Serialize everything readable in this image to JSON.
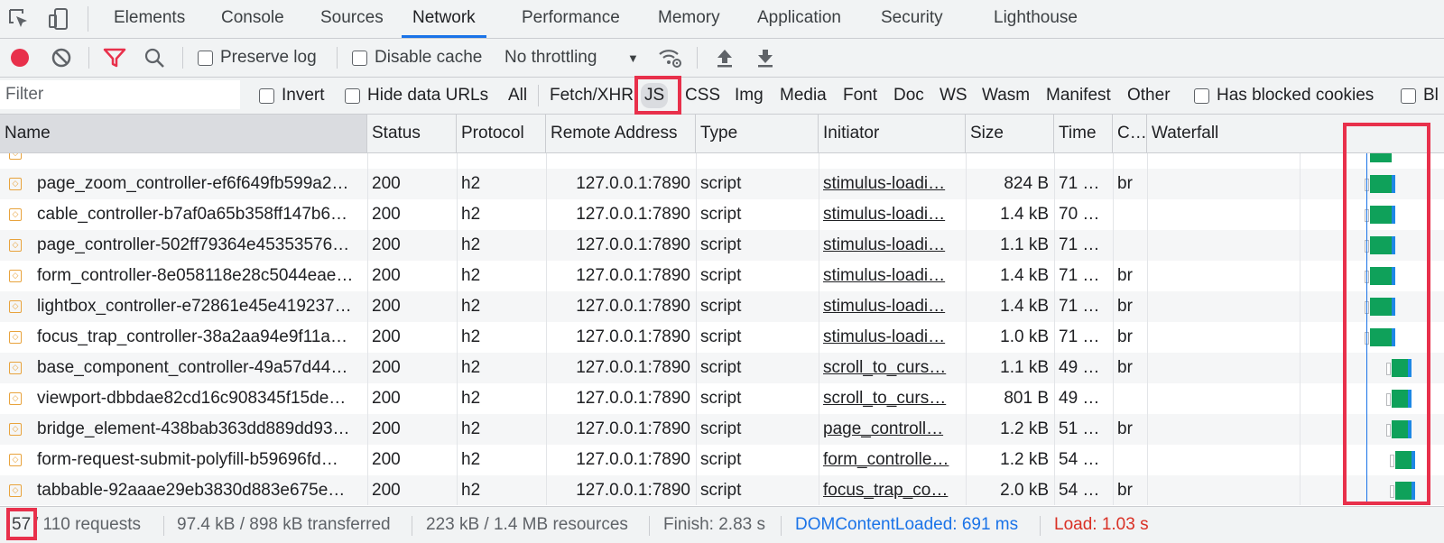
{
  "tabs": [
    "Elements",
    "Console",
    "Sources",
    "Network",
    "Performance",
    "Memory",
    "Application",
    "Security",
    "Lighthouse"
  ],
  "active_tab": "Network",
  "toolbar": {
    "preserve_log": "Preserve log",
    "disable_cache": "Disable cache",
    "throttling": "No throttling"
  },
  "filterbar": {
    "placeholder": "Filter",
    "invert": "Invert",
    "hide_data_urls": "Hide data URLs",
    "types": [
      "All",
      "Fetch/XHR",
      "JS",
      "CSS",
      "Img",
      "Media",
      "Font",
      "Doc",
      "WS",
      "Wasm",
      "Manifest",
      "Other"
    ],
    "selected_type": "JS",
    "has_blocked_cookies": "Has blocked cookies",
    "blocked_requests_partial": "Bl"
  },
  "columns": [
    "Name",
    "Status",
    "Protocol",
    "Remote Address",
    "Type",
    "Initiator",
    "Size",
    "Time",
    "C…",
    "Waterfall"
  ],
  "rows": [
    {
      "name": "page_zoom_controller-ef6f649fb599a2…",
      "status": "200",
      "protocol": "h2",
      "remote": "127.0.0.1:7890",
      "type": "script",
      "initiator": "stimulus-loadi…",
      "size": "824 B",
      "time": "71 …",
      "content_encoding": "br"
    },
    {
      "name": "cable_controller-b7af0a65b358ff147b6…",
      "status": "200",
      "protocol": "h2",
      "remote": "127.0.0.1:7890",
      "type": "script",
      "initiator": "stimulus-loadi…",
      "size": "1.4 kB",
      "time": "70 …",
      "content_encoding": ""
    },
    {
      "name": "page_controller-502ff79364e45353576…",
      "status": "200",
      "protocol": "h2",
      "remote": "127.0.0.1:7890",
      "type": "script",
      "initiator": "stimulus-loadi…",
      "size": "1.1 kB",
      "time": "71 …",
      "content_encoding": ""
    },
    {
      "name": "form_controller-8e058118e28c5044eae…",
      "status": "200",
      "protocol": "h2",
      "remote": "127.0.0.1:7890",
      "type": "script",
      "initiator": "stimulus-loadi…",
      "size": "1.4 kB",
      "time": "71 …",
      "content_encoding": "br"
    },
    {
      "name": "lightbox_controller-e72861e45e419237…",
      "status": "200",
      "protocol": "h2",
      "remote": "127.0.0.1:7890",
      "type": "script",
      "initiator": "stimulus-loadi…",
      "size": "1.4 kB",
      "time": "71 …",
      "content_encoding": "br"
    },
    {
      "name": "focus_trap_controller-38a2aa94e9f11a…",
      "status": "200",
      "protocol": "h2",
      "remote": "127.0.0.1:7890",
      "type": "script",
      "initiator": "stimulus-loadi…",
      "size": "1.0 kB",
      "time": "71 …",
      "content_encoding": "br"
    },
    {
      "name": "base_component_controller-49a57d44…",
      "status": "200",
      "protocol": "h2",
      "remote": "127.0.0.1:7890",
      "type": "script",
      "initiator": "scroll_to_curs…",
      "size": "1.1 kB",
      "time": "49 …",
      "content_encoding": "br"
    },
    {
      "name": "viewport-dbbdae82cd16c908345f15de…",
      "status": "200",
      "protocol": "h2",
      "remote": "127.0.0.1:7890",
      "type": "script",
      "initiator": "scroll_to_curs…",
      "size": "801 B",
      "time": "49 …",
      "content_encoding": ""
    },
    {
      "name": "bridge_element-438bab363dd889dd93…",
      "status": "200",
      "protocol": "h2",
      "remote": "127.0.0.1:7890",
      "type": "script",
      "initiator": "page_controll…",
      "size": "1.2 kB",
      "time": "51 …",
      "content_encoding": "br"
    },
    {
      "name": "form-request-submit-polyfill-b59696fd…",
      "status": "200",
      "protocol": "h2",
      "remote": "127.0.0.1:7890",
      "type": "script",
      "initiator": "form_controlle…",
      "size": "1.2 kB",
      "time": "54 …",
      "content_encoding": ""
    },
    {
      "name": "tabbable-92aaae29eb3830d883e675e…",
      "status": "200",
      "protocol": "h2",
      "remote": "127.0.0.1:7890",
      "type": "script",
      "initiator": "focus_trap_co…",
      "size": "2.0 kB",
      "time": "54 …",
      "content_encoding": "br"
    }
  ],
  "status_bar": {
    "shown_count": "57",
    "requests_text": "/ 110 requests",
    "transferred": "97.4 kB / 898 kB transferred",
    "resources": "223 kB / 1.4 MB resources",
    "finish": "Finish: 2.83 s",
    "dom_content_loaded": "DOMContentLoaded: 691 ms",
    "load": "Load: 1.03 s"
  },
  "colors": {
    "record": "#e8304b",
    "filter_active": "#e8304b",
    "highlight": "#e8304b",
    "waterfall_green": "#0fa15a",
    "waterfall_blue": "#1e88e5",
    "dcl": "#1a73e8",
    "load": "#d93025"
  }
}
